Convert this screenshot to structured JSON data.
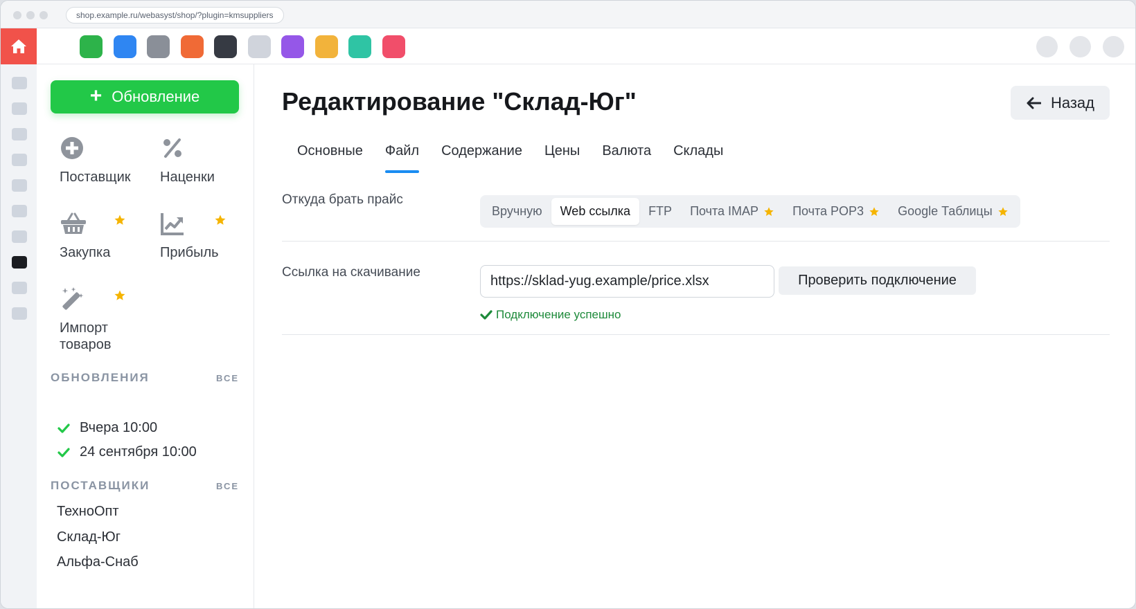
{
  "browser": {
    "url": "shop.example.ru/webasyst/shop/?plugin=kmsuppliers"
  },
  "topbar": {
    "app_icon_colors": [
      "#2db34a",
      "#2f86f2",
      "#8a8f98",
      "#f06a36",
      "#363a43",
      "#d0d4dc",
      "#9557e8",
      "#f2b33b",
      "#2fc4a4",
      "#f14e6a"
    ]
  },
  "sidebar": {
    "update_button": "Обновление",
    "tiles": [
      {
        "label": "Поставщик",
        "icon": "plus-circle-icon",
        "starred": false
      },
      {
        "label": "Наценки",
        "icon": "percent-icon",
        "starred": false
      },
      {
        "label": "Закупка",
        "icon": "basket-icon",
        "starred": true
      },
      {
        "label": "Прибыль",
        "icon": "chart-line-icon",
        "starred": true
      },
      {
        "label_line1": "Импорт",
        "label_line2": "товаров",
        "icon": "magic-wand-icon",
        "starred": true
      }
    ],
    "updates_title": "ОБНОВЛЕНИЯ",
    "updates_all": "ВСЕ",
    "updates": [
      "Вчера 10:00",
      "24 сентября 10:00"
    ],
    "suppliers_title": "ПОСТАВЩИКИ",
    "suppliers_all": "ВСЕ",
    "suppliers": [
      "ТехноОпт",
      "Склад-Юг",
      "Альфа-Снаб"
    ]
  },
  "main": {
    "title": "Редактирование \"Склад-Юг\"",
    "back_button": "Назад",
    "tabs": [
      "Основные",
      "Файл",
      "Содержание",
      "Цены",
      "Валюта",
      "Склады"
    ],
    "active_tab": "Файл",
    "source_label": "Откуда брать прайс",
    "source_options": [
      {
        "label": "Вручную",
        "starred": false
      },
      {
        "label": "Web ссылка",
        "starred": false
      },
      {
        "label": "FTP",
        "starred": false
      },
      {
        "label": "Почта IMAP",
        "starred": true
      },
      {
        "label": "Почта POP3",
        "starred": true
      },
      {
        "label": "Google Таблицы",
        "starred": true
      }
    ],
    "source_selected": "Web ссылка",
    "download_label": "Ссылка на скачивание",
    "download_url": "https://sklad-yug.example/price.xlsx",
    "check_button": "Проверить подключение",
    "status": "Подключение успешно",
    "accent_color": "#1a8cf2",
    "star_color": "#f5b400",
    "success_color": "#1d8a3a"
  }
}
